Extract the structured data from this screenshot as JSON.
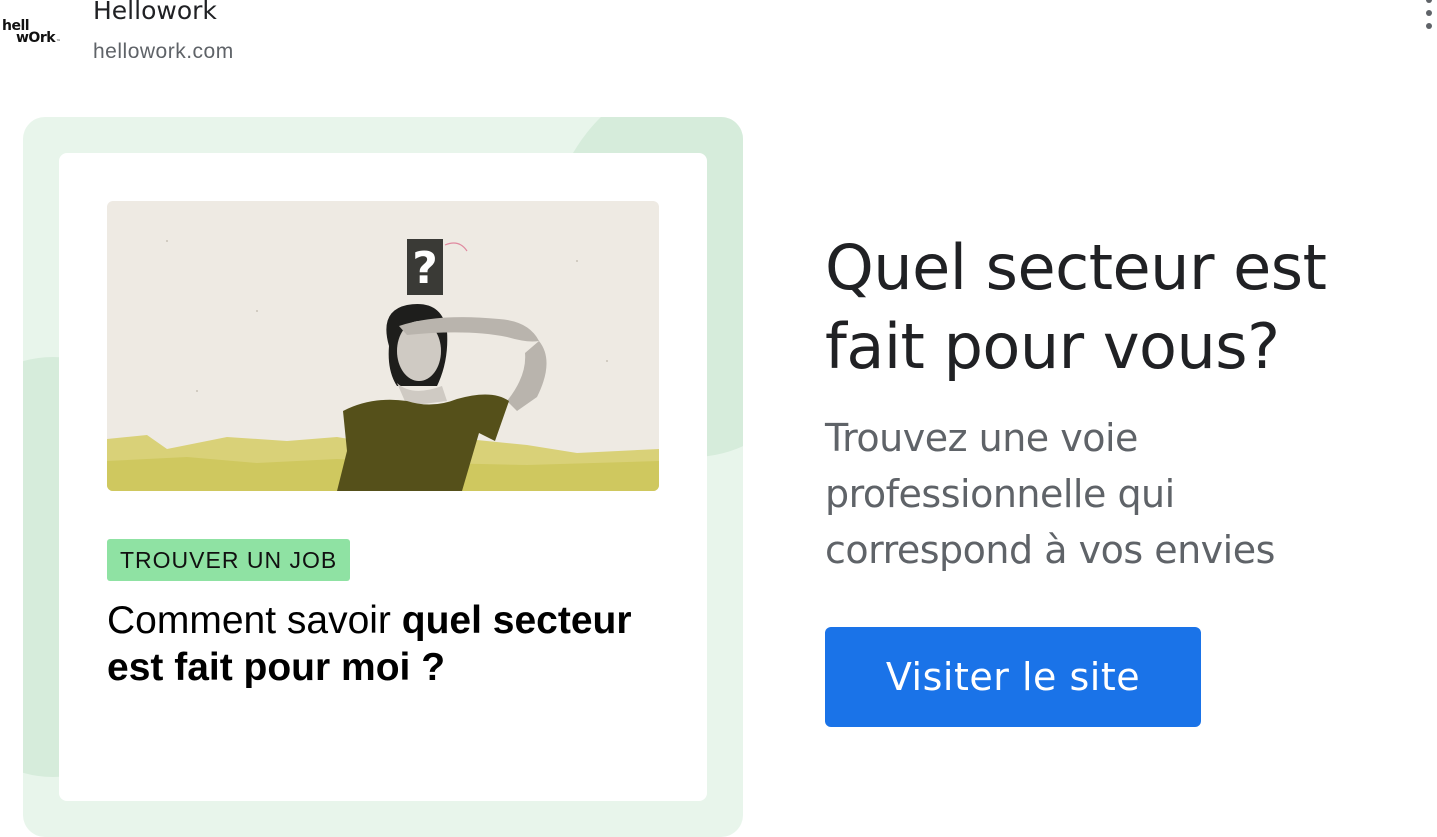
{
  "advertiser": {
    "logo_line1": "hell",
    "logo_line2": "wOrk",
    "logo_tm": "™",
    "name": "Hellowork",
    "domain": "hellowork.com"
  },
  "menu": {
    "icon": "more-vert-icon"
  },
  "creative": {
    "tag": "TROUVER UN JOB",
    "headline_regular": "Comment savoir ",
    "headline_bold": "quel secteur est fait pour moi ?",
    "question_mark": "?"
  },
  "ad": {
    "title": "Quel secteur est fait pour vous?",
    "description": "Trouvez une voie professionnelle qui correspond à vos envies",
    "cta_label": "Visiter le site"
  },
  "colors": {
    "cta": "#1a73e8",
    "tag_bg": "#8fe2a3",
    "frame_bg": "#e8f5eb",
    "title": "#202124",
    "description": "#5f6368"
  }
}
